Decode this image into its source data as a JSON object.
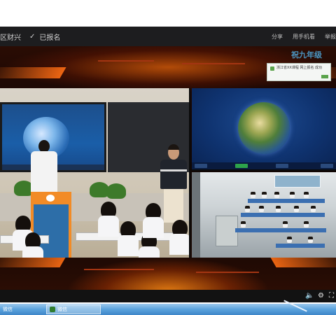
{
  "topbar": {
    "crumb": "区财兴",
    "check_icon": "✓",
    "status": "已报名",
    "actions": [
      "分享",
      "用手机看",
      "举报"
    ]
  },
  "overlay": {
    "logo_text": "祝九年级",
    "popup_text": "浙江省XX课程 网上报名 成功",
    "popup_button_color": "#5aa34b"
  },
  "player": {
    "accent_color": "#ff7a10",
    "controls": {
      "volume_icon": "🔈",
      "settings_icon": "⚙",
      "fullscreen_icon": "⛶"
    }
  },
  "taskbar": {
    "items": [
      {
        "label": "微信",
        "icon": "app-icon"
      },
      {
        "label": "微信",
        "icon": "wechat-icon"
      }
    ]
  }
}
